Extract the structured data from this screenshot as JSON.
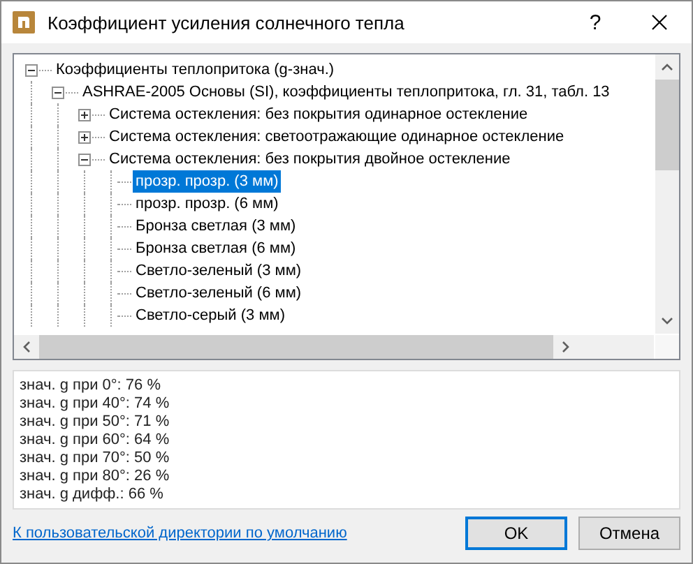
{
  "window": {
    "title": "Коэффициент усиления солнечного тепла",
    "help": "?"
  },
  "tree": [
    {
      "label": "Коэффициенты теплопритока (g-знач.)",
      "expanded": true,
      "selected": false,
      "children": [
        {
          "label": "ASHRAE-2005 Основы (SI), коэффициенты теплопритока, гл. 31, табл. 13",
          "expanded": true,
          "selected": false,
          "children": [
            {
              "label": "Система остекления: без покрытия одинарное остекление",
              "expanded": false,
              "selected": false
            },
            {
              "label": "Система остекления: светоотражающие одинарное остекление",
              "expanded": false,
              "selected": false
            },
            {
              "label": "Система остекления: без покрытия двойное остекление",
              "expanded": true,
              "selected": false,
              "children": [
                {
                  "label": "прозр. прозр. (3 мм)",
                  "selected": true
                },
                {
                  "label": "прозр. прозр. (6 мм)",
                  "selected": false
                },
                {
                  "label": "Бронза светлая (3 мм)",
                  "selected": false
                },
                {
                  "label": "Бронза светлая (6 мм)",
                  "selected": false
                },
                {
                  "label": "Светло-зеленый (3 мм)",
                  "selected": false
                },
                {
                  "label": "Светло-зеленый (6 мм)",
                  "selected": false
                },
                {
                  "label": "Светло-серый (3 мм)",
                  "selected": false
                }
              ]
            }
          ]
        }
      ]
    }
  ],
  "details": [
    "знач. g при 0°: 76 %",
    "знач. g при 40°: 74 %",
    "знач. g при 50°: 71 %",
    "знач. g при 60°: 64 %",
    "знач. g при 70°: 50 %",
    "знач. g при 80°: 26 %",
    "знач. g дифф.: 66 %"
  ],
  "link": "К пользовательской директории по умолчанию",
  "buttons": [
    {
      "label": "OK",
      "default": true
    },
    {
      "label": "Отмена",
      "default": false
    }
  ]
}
